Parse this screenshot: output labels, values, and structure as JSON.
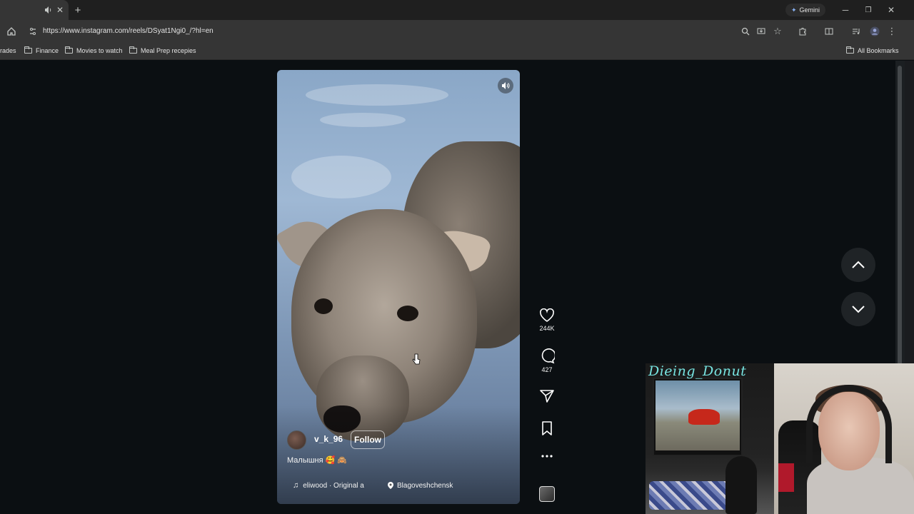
{
  "browser": {
    "address_bar": {
      "url": "https://www.instagram.com/reels/DSyat1Ngi0_/?hl=en"
    },
    "gemini_label": "Gemini",
    "bookmarks": {
      "partial_item": "rades",
      "items": [
        "Finance",
        "Movies to watch",
        "Meal Prep recepies"
      ],
      "all_bookmarks": "All Bookmarks"
    }
  },
  "reel": {
    "username": "v_k_96",
    "follow_label": "Follow",
    "caption": "Малышня 🥰 🙈",
    "audio_label": "eliwood · Original a",
    "location": "Blagoveshchensk",
    "likes": "244K",
    "comments": "427"
  },
  "webcam": {
    "overlay_name": "Dieing_Donut"
  },
  "colors": {
    "page_bg": "#0b0f12",
    "chrome_bg": "#353535",
    "webcam_name": "#77e3e0"
  }
}
